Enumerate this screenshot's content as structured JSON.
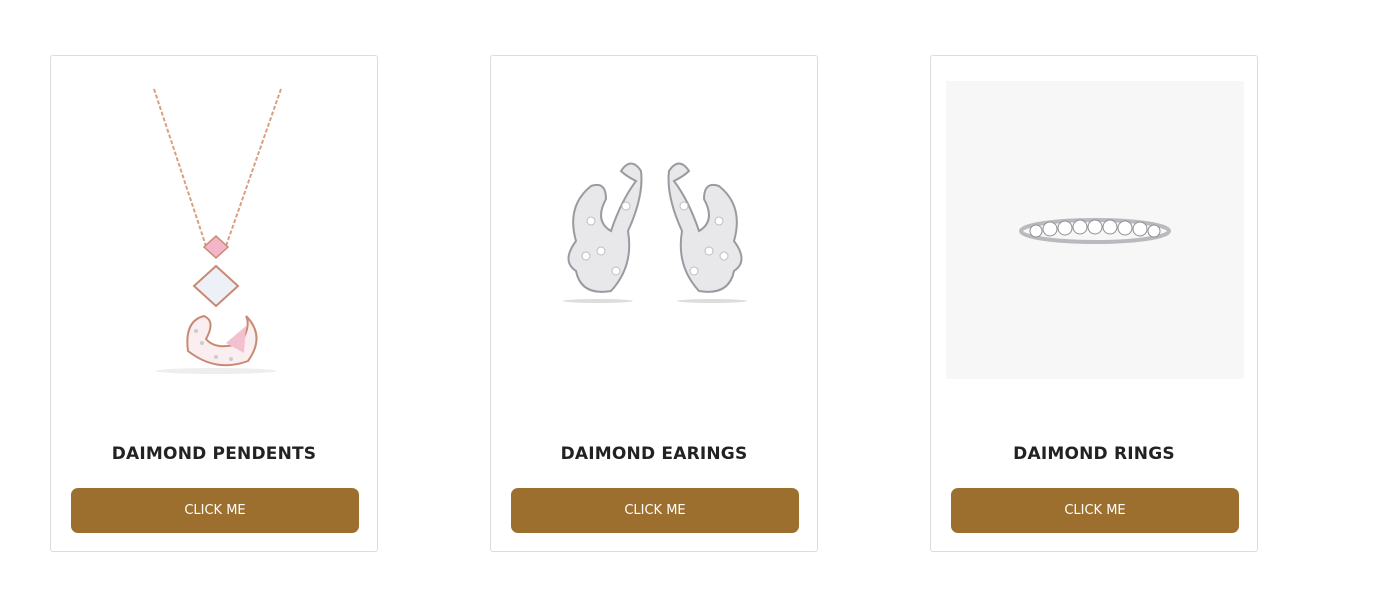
{
  "cards": [
    {
      "title": "DAIMOND PENDENTS",
      "button_label": "CLICK ME"
    },
    {
      "title": "DAIMOND EARINGS",
      "button_label": "CLICK ME"
    },
    {
      "title": "DAIMOND RINGS",
      "button_label": "CLICK ME"
    }
  ],
  "colors": {
    "button_bg": "#9c6f2f",
    "card_border": "#dcdcdc"
  },
  "icons": [
    "pendant-image",
    "earrings-image",
    "ring-image"
  ]
}
